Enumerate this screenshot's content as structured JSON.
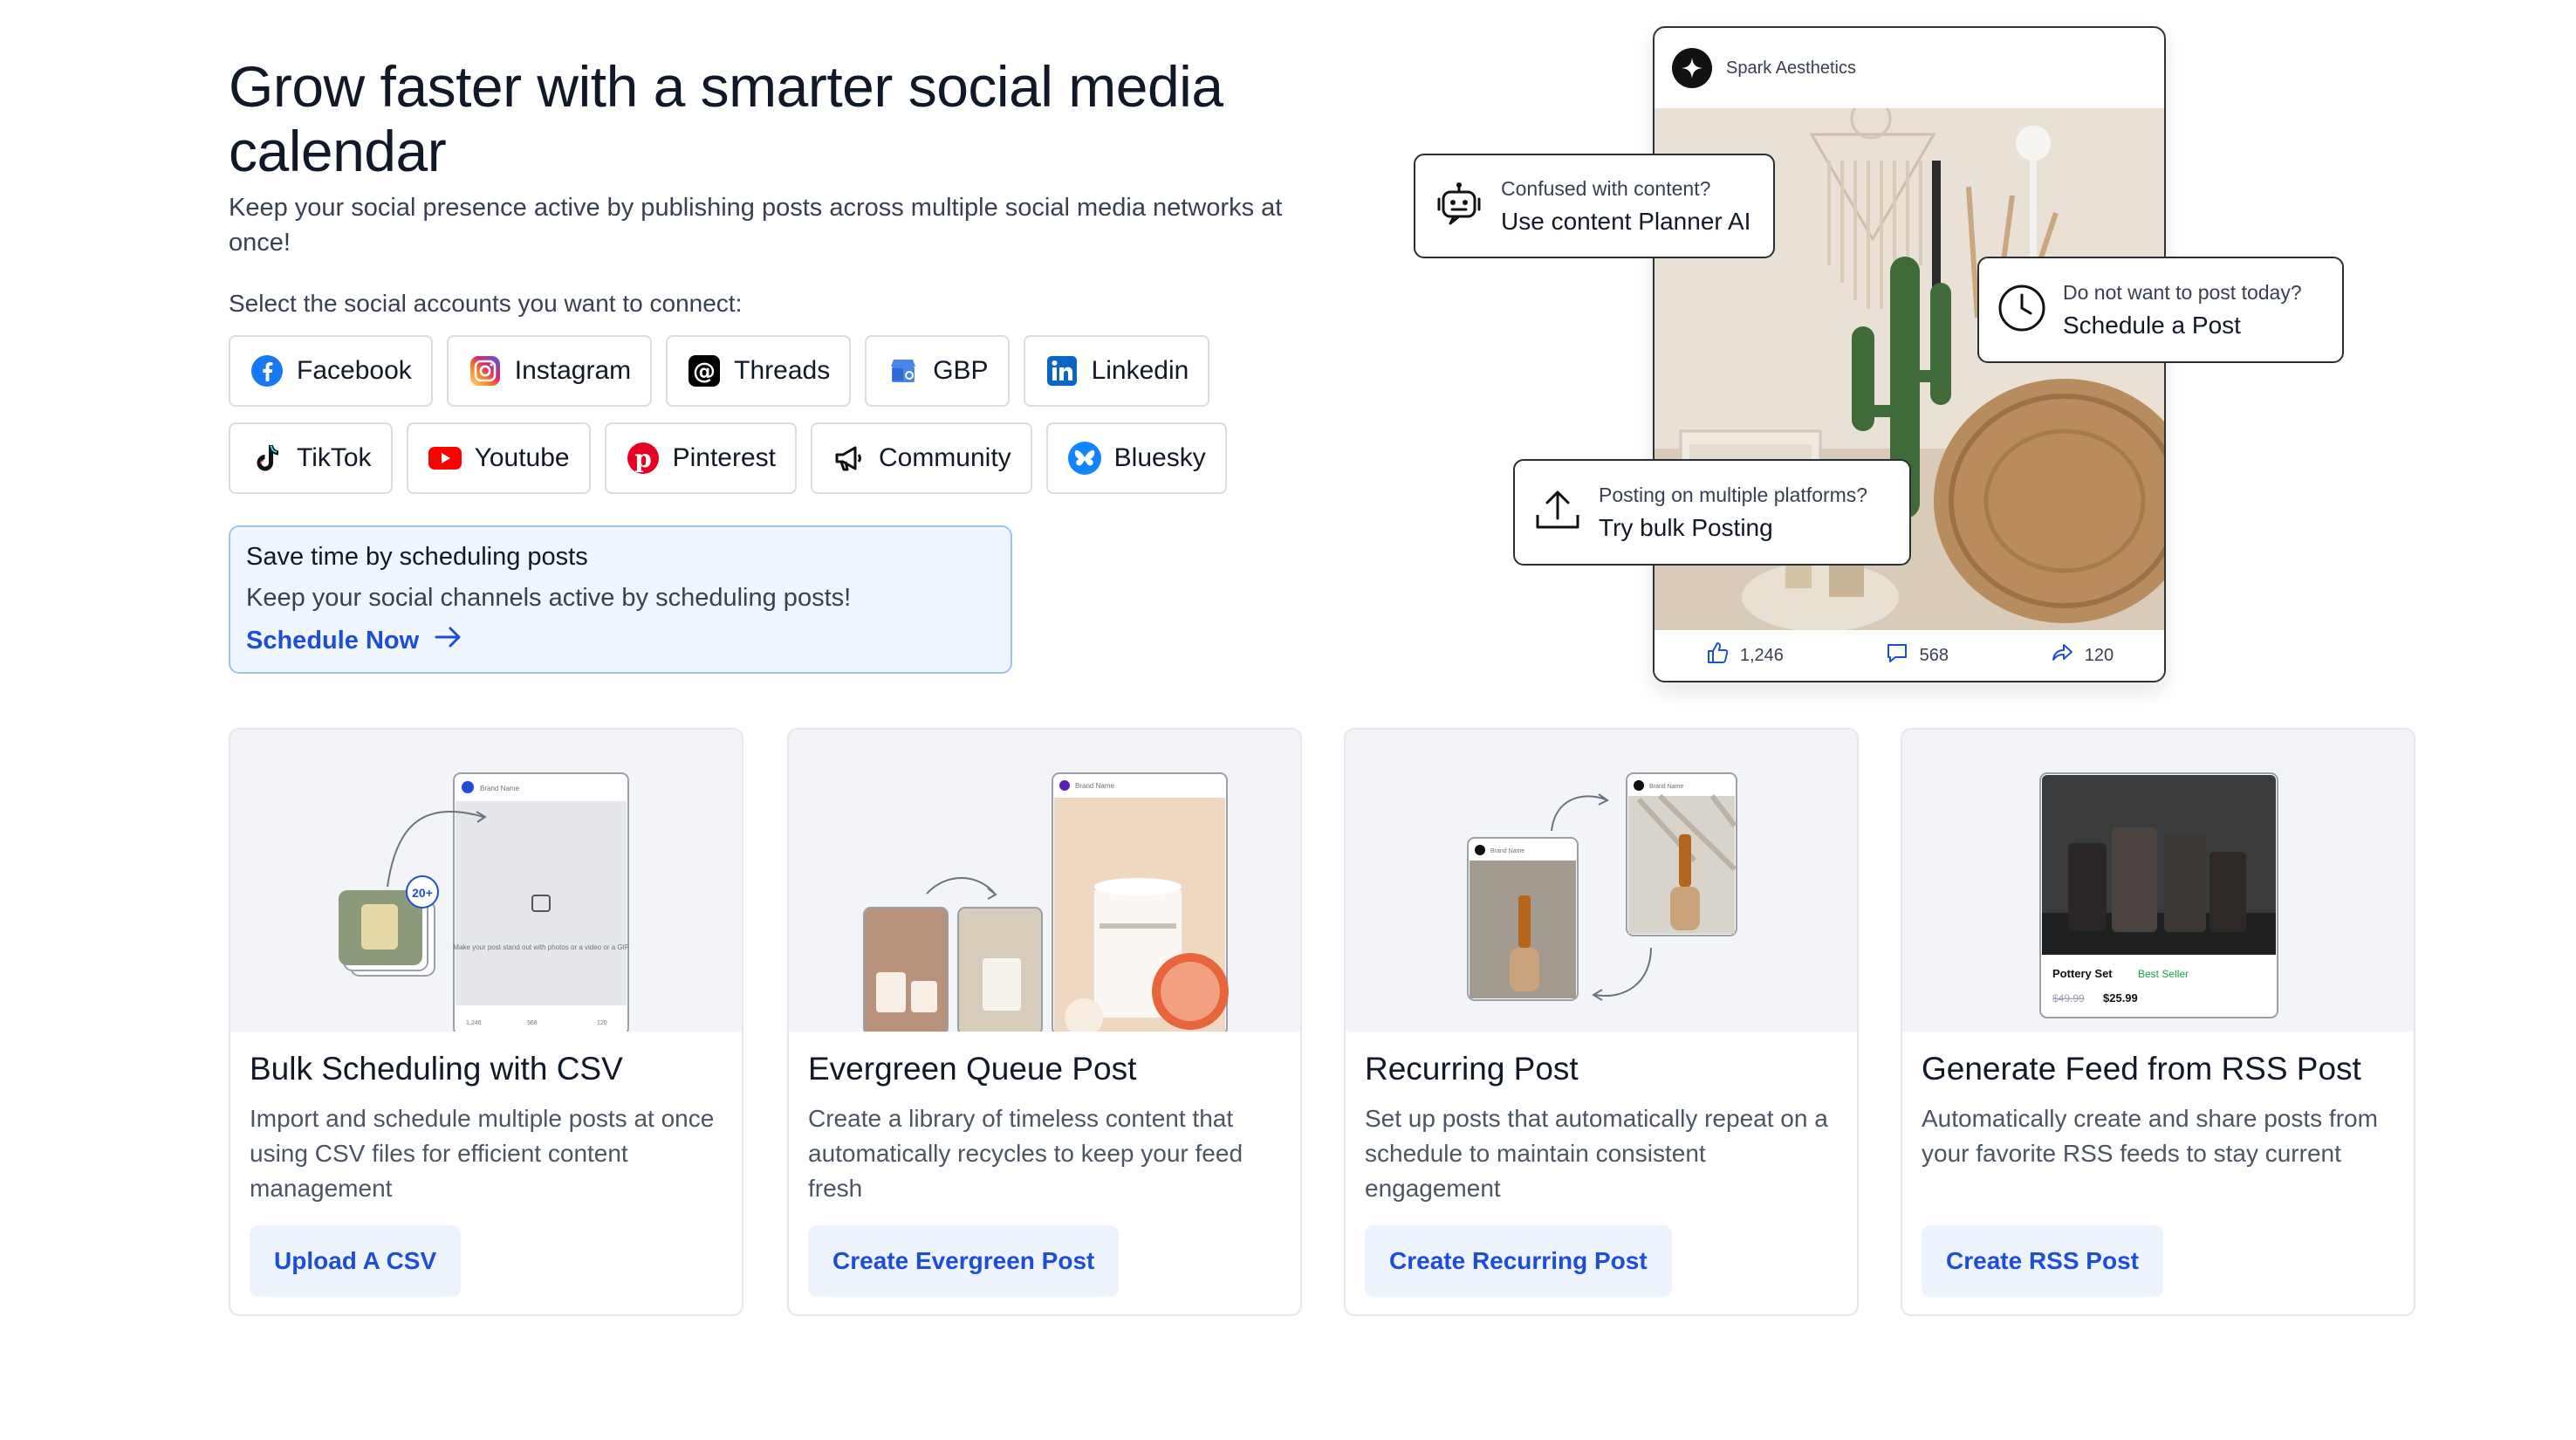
{
  "hero": {
    "title": "Grow faster with a smarter social media calendar",
    "subtitle": "Keep your social presence active by publishing posts across multiple social media networks at once!",
    "select_label": "Select the social accounts you want to connect:"
  },
  "networks_row1": [
    {
      "label": "Facebook",
      "icon": "facebook-icon"
    },
    {
      "label": "Instagram",
      "icon": "instagram-icon"
    },
    {
      "label": "Threads",
      "icon": "threads-icon"
    },
    {
      "label": "GBP",
      "icon": "gbp-icon"
    },
    {
      "label": "Linkedin",
      "icon": "linkedin-icon"
    }
  ],
  "networks_row2": [
    {
      "label": "TikTok",
      "icon": "tiktok-icon"
    },
    {
      "label": "Youtube",
      "icon": "youtube-icon"
    },
    {
      "label": "Pinterest",
      "icon": "pinterest-icon"
    },
    {
      "label": "Community",
      "icon": "megaphone-icon"
    },
    {
      "label": "Bluesky",
      "icon": "bluesky-icon"
    }
  ],
  "promo": {
    "title": "Save time by scheduling posts",
    "text": "Keep your social channels active by scheduling posts!",
    "link": "Schedule Now"
  },
  "post_preview": {
    "brand": "Spark Aesthetics",
    "likes": "1,246",
    "comments": "568",
    "shares": "120"
  },
  "callouts": {
    "planner": {
      "question": "Confused with content?",
      "action": "Use content Planner AI"
    },
    "schedule": {
      "question": "Do not want to post today?",
      "action": "Schedule a Post"
    },
    "bulk": {
      "question": "Posting on multiple platforms?",
      "action": "Try bulk Posting"
    }
  },
  "cards": [
    {
      "title": "Bulk Scheduling with CSV",
      "desc": "Import and schedule multiple posts at once using CSV files for efficient content management",
      "button": "Upload A CSV"
    },
    {
      "title": "Evergreen Queue Post",
      "desc": "Create a library of timeless content that automatically recycles to keep your feed fresh",
      "button": "Create Evergreen Post"
    },
    {
      "title": "Recurring Post",
      "desc": "Set up posts that automatically repeat on a schedule to maintain consistent engagement",
      "button": "Create Recurring Post"
    },
    {
      "title": "Generate Feed from RSS Post",
      "desc": "Automatically create and share posts from your favorite RSS feeds to stay current",
      "button": "Create RSS Post"
    }
  ],
  "card_art": {
    "bulk_badge": "20+",
    "bulk_brand": "Brand Name",
    "bulk_hint": "Make your post stand out with photos or a video or a GIF",
    "bulk_likes": "1,246",
    "bulk_comments": "568",
    "bulk_shares": "120",
    "evergreen_brand": "Brand Name",
    "recurring_brand_a": "Brand Name",
    "recurring_brand_b": "Brand Name",
    "rss_product": "Pottery Set",
    "rss_badge": "Best Seller",
    "rss_old_price": "$49.99",
    "rss_price": "$25.99"
  },
  "colors": {
    "accent": "#1d4ed8",
    "promo_bg": "#f0f6ff",
    "promo_border": "#9fc2f3",
    "button_bg": "#eef4fe"
  }
}
